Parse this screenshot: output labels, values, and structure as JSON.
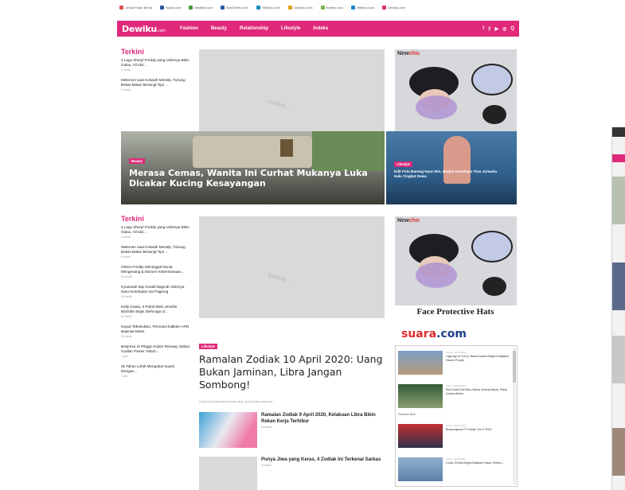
{
  "network_bar": [
    {
      "label": "Jurnal Pasar Berita",
      "color": "#d9534f"
    },
    {
      "label": "Suara.com",
      "color": "#2b57a8"
    },
    {
      "label": "Mediktiv.com",
      "color": "#4a9a3a"
    },
    {
      "label": "BolaTimes.com",
      "color": "#2b57a8"
    },
    {
      "label": "HiTekno.com",
      "color": "#1e88c8"
    },
    {
      "label": "Guideku.com",
      "color": "#e0a020"
    },
    {
      "label": "Iloveku.com",
      "color": "#7ab648"
    },
    {
      "label": "Hitekno.com",
      "color": "#1e88c8"
    },
    {
      "label": "Dewiku.com",
      "color": "#e0297a"
    }
  ],
  "nav": {
    "logo": "Dewiku",
    "logo_suffix": ".com",
    "menu": [
      "Fashion",
      "Beauty",
      "Relationship",
      "Lifestyle",
      "Indeks"
    ],
    "social": [
      "f",
      "y",
      "▶",
      "◎",
      "Q"
    ]
  },
  "terkini_top": {
    "heading": "Terkini",
    "items": [
      {
        "title": "4 Lagu Sheryl Freddy yang Unikmya Bikin Galau, All Idol...",
        "time": "5 menit"
      },
      {
        "title": "Melemen saat Kekasih Menelp, Tuhung Bekas Bakar Bertungl Tips ...",
        "time": "8 menit"
      }
    ]
  },
  "loading": "loading...",
  "ad": {
    "brand_pre": "New",
    "brand_post": "chic",
    "caption": "Face Protective Hats"
  },
  "hero": {
    "main_badge": "Beauty",
    "main_title": "Merasa Cemas, Wanita Ini Curhat Mukanya Luka Dicakar Kucing Kesayangan",
    "side_badge": "Lifestyle",
    "side_title": "Edit Foto Bareng Hyun Bin, Bugini Kesadaya Tiwa Jarwaha Halu Tingkat Dewa"
  },
  "terkini_bottom": {
    "heading": "Terkini",
    "items": [
      {
        "title": "4 Lagu Sheryl Freddy yang Unikmya Bikin Galau, All Idol...",
        "time": "5 menit"
      },
      {
        "title": "Melemen saat Kekasih Menelp, Tuhung Bekas Bakar Bertungl Tips ...",
        "time": "8 menit"
      },
      {
        "title": "Olesin Freddy Meninggal Dunia, Mengenang & Momen Kebersamaan...",
        "time": "20 menit"
      },
      {
        "title": "Kyowarah tiap Kreatif Bagindi Unikmya Daru Kesehatan Ala Pagemg",
        "time": "32 menit"
      },
      {
        "title": "Kelly Grada, 5 Potret Bebi Jennifer Bachdim Bajin Diehcaga ol...",
        "time": "40 menit"
      },
      {
        "title": "Kayuk Tekrelukiko, Pernesol Indiklen APD Bajenas-Mami",
        "time": "52 menit"
      },
      {
        "title": "Berjemur di Pinggir Kolam Renang, Walan Gudlan Pamer Tubuh...",
        "time": "1 jam"
      },
      {
        "title": "25 Tahun Lebih Mengobat Suami Dengan...",
        "time": "1 jam"
      }
    ]
  },
  "article": {
    "badge": "Lifestyle",
    "title": "Ramalan Zodiak 10 April 2020: Uang Bukan Jaminan, Libra Jangan Sombong!",
    "meta": "Zodiak libra diprediksi tentang uang, perlu jangan sombong..."
  },
  "related": [
    {
      "title": "Ramalan Zodiak 9 April 2020, Kelakuan Libra Bikin Rekan Kerja Terhibur",
      "time": "Kemarin"
    },
    {
      "title": "Punya Jiwa yang Keras, 4 Zodiak Ini Terkenal Sarkas",
      "time": "Kemarin"
    }
  ],
  "suara": {
    "logo_pre": "suara",
    "logo_post": ".com",
    "items": [
      {
        "time": "Kamis, 09/04/2020",
        "title": "Lagi-lagi Ini Turun, Bakal Jokowi Sikapi Kebijakan Diskon Proyek"
      },
      {
        "time": "Kamis, 09/04/2020",
        "title": "Pilot Gusti Dari Baru Bisnis Smarty Bakar, Pakar Unzera Beber"
      },
      {
        "time": "Kamis, 09/04/2020",
        "title": "Bhasnogkara F1 Hoklar Can 5 2020"
      },
      {
        "time": "Kamis, 09/04/2020",
        "title": "Covid 19 Ada Begini Balakan Kasus Terbaru..."
      }
    ],
    "item_caption": "Peruntan Berit"
  }
}
